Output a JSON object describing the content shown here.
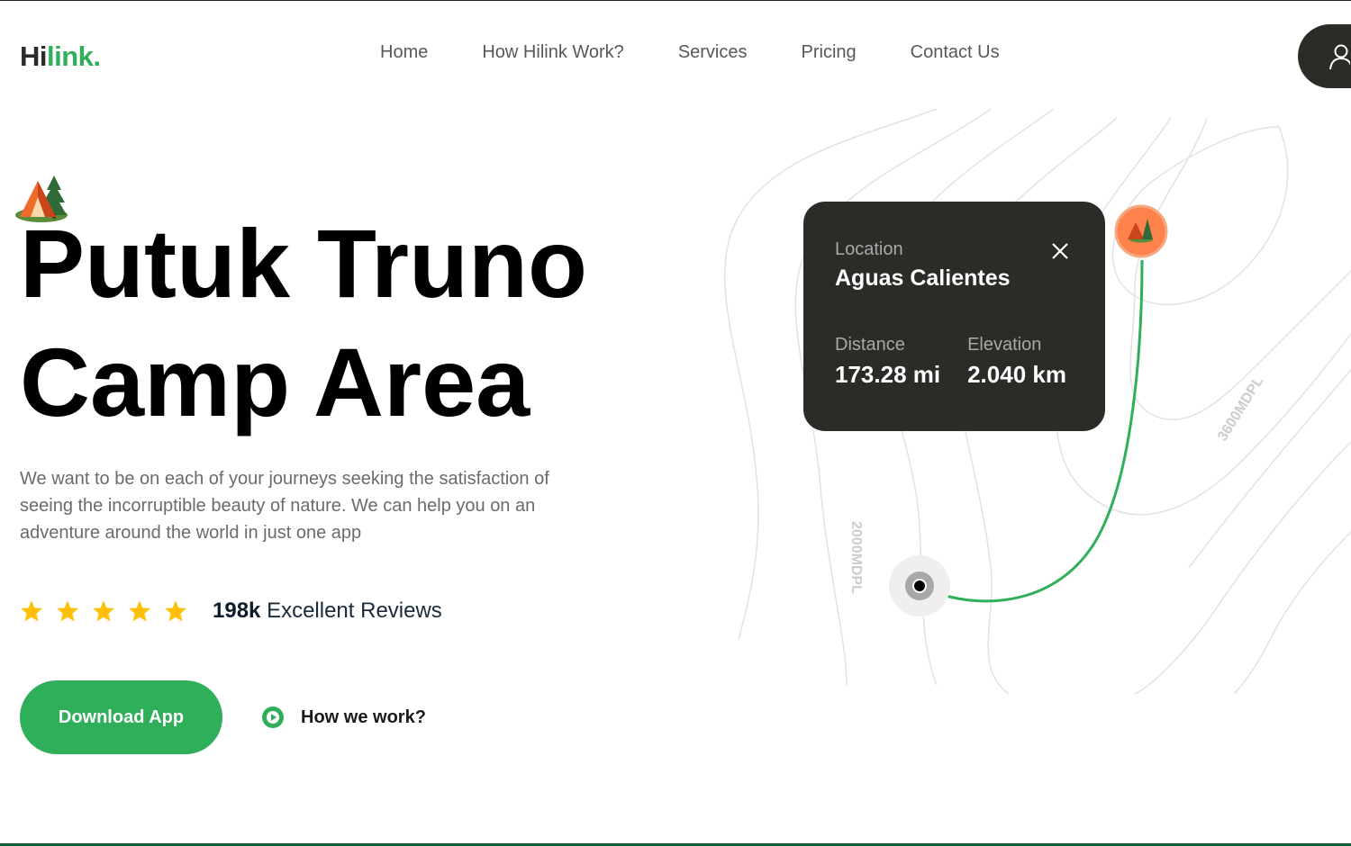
{
  "brand": {
    "name_dark": "Hi",
    "name_green": "link.",
    "colors": {
      "primary_green": "#30af5b",
      "dark": "#292c27",
      "accent_orange": "#ff814c"
    }
  },
  "nav": {
    "items": [
      {
        "label": "Home"
      },
      {
        "label": "How Hilink Work?"
      },
      {
        "label": "Services"
      },
      {
        "label": "Pricing"
      },
      {
        "label": "Contact Us"
      }
    ],
    "login_icon": "user-icon"
  },
  "hero": {
    "title_line1": "Putuk Truno",
    "title_line2": "Camp Area",
    "description": "We want to be on each of your journeys seeking the satisfaction of seeing the incorruptible beauty of nature. We can help you on an adventure around the world in just one app",
    "rating": {
      "stars": 5,
      "count": "198k",
      "label": "Excellent Reviews"
    },
    "download_label": "Download App",
    "how_work_label": "How we work?"
  },
  "map": {
    "card": {
      "location_label": "Location",
      "location_value": "Aguas Calientes",
      "distance_label": "Distance",
      "distance_value": "173.28 mi",
      "elevation_label": "Elevation",
      "elevation_value": "2.040 km"
    },
    "contour_labels": [
      "2000MDPL",
      "3600MDPL"
    ],
    "pin_icon": "camp-tent-icon",
    "start_icon": "location-dot-icon"
  }
}
